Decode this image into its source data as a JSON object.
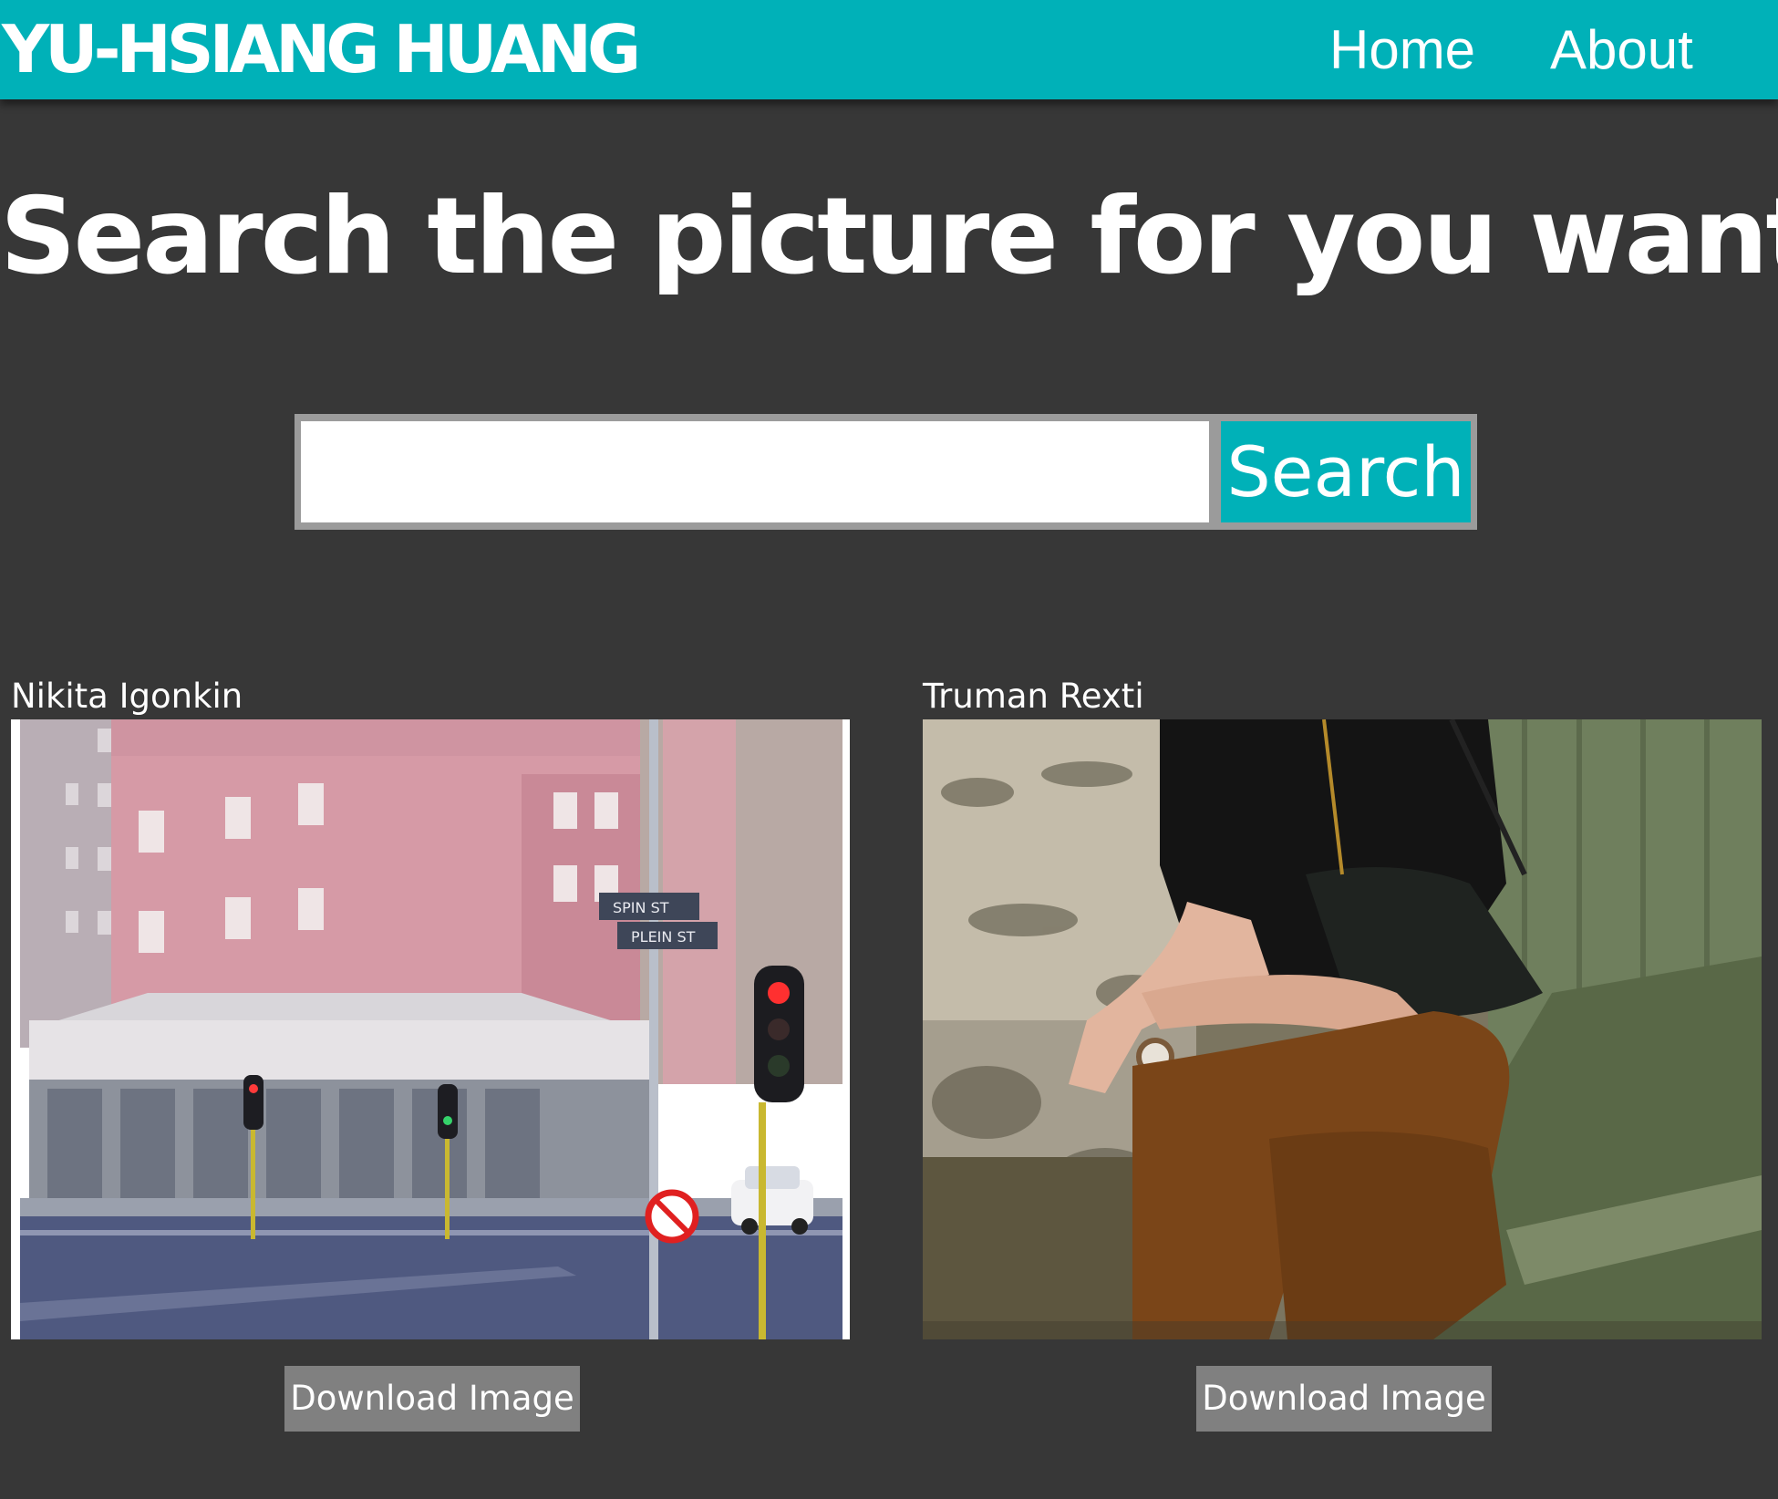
{
  "header": {
    "brand": "YU-HSIANG HUANG",
    "nav": [
      {
        "label": "Home"
      },
      {
        "label": "About"
      }
    ]
  },
  "hero": {
    "title": "Search the picture for you want"
  },
  "search": {
    "value": "",
    "placeholder": "",
    "button_label": "Search"
  },
  "results": [
    {
      "photographer": "Nikita Igonkin",
      "download_label": "Download Image",
      "sign_text": "SPIN ST",
      "sign_text_2": "PLEIN ST"
    },
    {
      "photographer": "Truman Rexti",
      "download_label": "Download Image"
    }
  ],
  "colors": {
    "accent": "#00b1b8",
    "background": "#373737",
    "button_gray": "#808080"
  }
}
